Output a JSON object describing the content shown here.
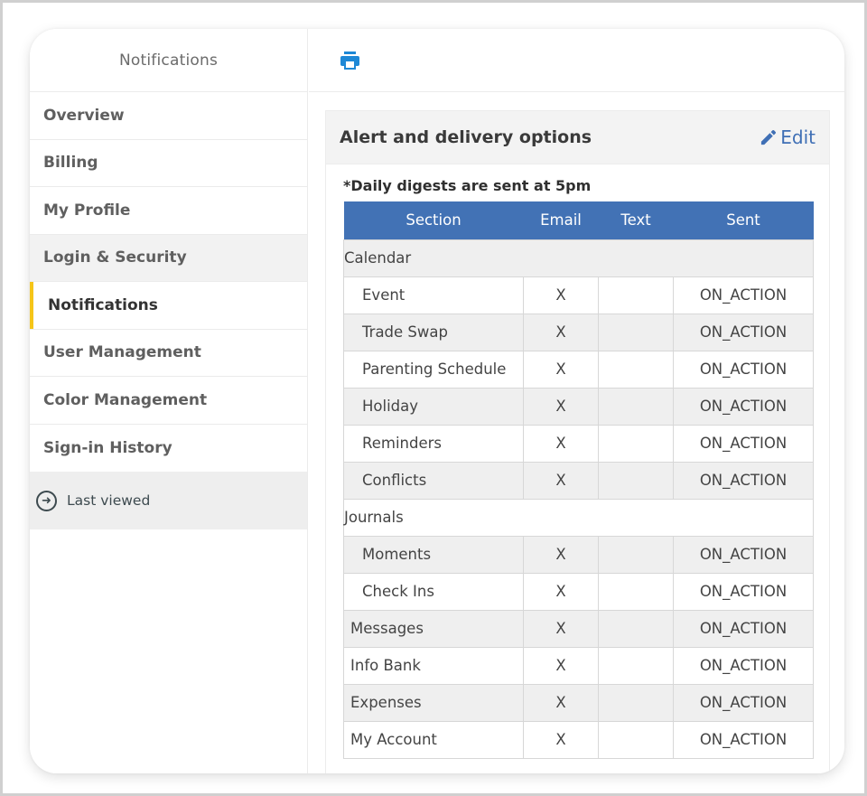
{
  "sidebar": {
    "title": "Notifications",
    "items": [
      {
        "label": "Overview",
        "state": "normal"
      },
      {
        "label": "Billing",
        "state": "normal"
      },
      {
        "label": "My Profile",
        "state": "normal"
      },
      {
        "label": "Login & Security",
        "state": "hover"
      },
      {
        "label": "Notifications",
        "state": "active"
      },
      {
        "label": "User Management",
        "state": "normal"
      },
      {
        "label": "Color Management",
        "state": "normal"
      },
      {
        "label": "Sign-in History",
        "state": "normal"
      }
    ],
    "last_viewed": {
      "label": "Last viewed",
      "icon": "arrow-circle-right-icon"
    }
  },
  "toolbar": {
    "print_icon": "print-icon"
  },
  "panel": {
    "title": "Alert and delivery options",
    "edit_label": "Edit",
    "edit_icon": "pencil-icon",
    "note": "*Daily digests are sent at 5pm",
    "columns": [
      "Section",
      "Email",
      "Text",
      "Sent"
    ],
    "rows": [
      {
        "type": "group",
        "section": "Calendar"
      },
      {
        "type": "sub",
        "section": "Event",
        "email": "X",
        "text": "",
        "sent": "ON_ACTION"
      },
      {
        "type": "sub",
        "section": "Trade Swap",
        "email": "X",
        "text": "",
        "sent": "ON_ACTION"
      },
      {
        "type": "sub",
        "section": "Parenting Schedule",
        "email": "X",
        "text": "",
        "sent": "ON_ACTION"
      },
      {
        "type": "sub",
        "section": "Holiday",
        "email": "X",
        "text": "",
        "sent": "ON_ACTION"
      },
      {
        "type": "sub",
        "section": "Reminders",
        "email": "X",
        "text": "",
        "sent": "ON_ACTION"
      },
      {
        "type": "sub",
        "section": "Conflicts",
        "email": "X",
        "text": "",
        "sent": "ON_ACTION"
      },
      {
        "type": "group",
        "section": "Journals"
      },
      {
        "type": "sub",
        "section": "Moments",
        "email": "X",
        "text": "",
        "sent": "ON_ACTION"
      },
      {
        "type": "sub",
        "section": "Check Ins",
        "email": "X",
        "text": "",
        "sent": "ON_ACTION"
      },
      {
        "type": "top",
        "section": "Messages",
        "email": "X",
        "text": "",
        "sent": "ON_ACTION"
      },
      {
        "type": "top",
        "section": "Info Bank",
        "email": "X",
        "text": "",
        "sent": "ON_ACTION"
      },
      {
        "type": "top",
        "section": "Expenses",
        "email": "X",
        "text": "",
        "sent": "ON_ACTION"
      },
      {
        "type": "top",
        "section": "My Account",
        "email": "X",
        "text": "",
        "sent": "ON_ACTION"
      }
    ]
  },
  "colors": {
    "accent_blue": "#4272b5",
    "link_blue": "#3f6fb5",
    "print_blue": "#1e88d6",
    "active_indicator": "#f5c518"
  }
}
